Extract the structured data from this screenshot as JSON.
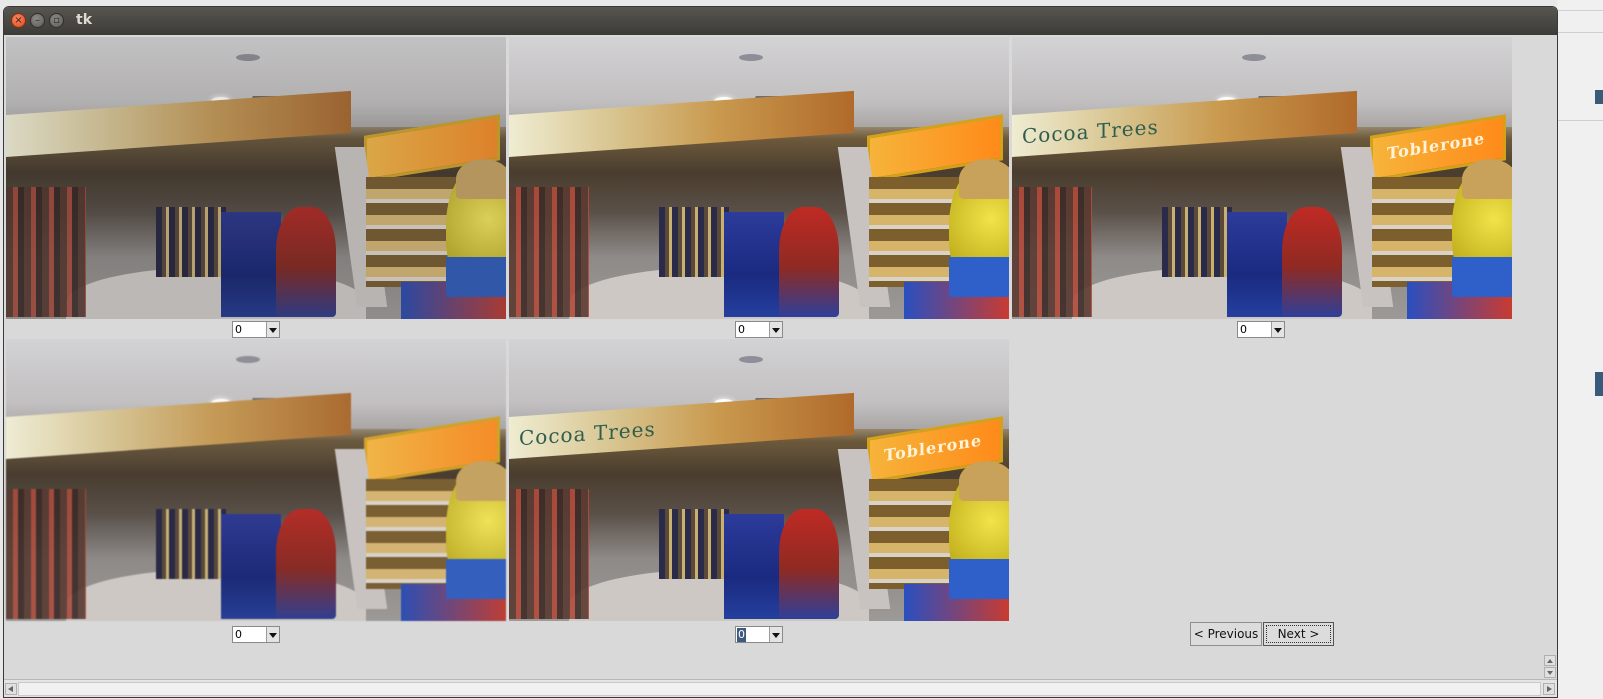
{
  "window": {
    "title": "tk"
  },
  "titlebar_buttons": {
    "close": "×",
    "minimize": "–",
    "maximize": "▫"
  },
  "images": [
    {
      "banner_text": "",
      "sign_text": ""
    },
    {
      "banner_text": "",
      "sign_text": ""
    },
    {
      "banner_text": "Cocoa Trees",
      "sign_text": "Toblerone"
    },
    {
      "banner_text": "",
      "sign_text": ""
    },
    {
      "banner_text": "Cocoa Trees",
      "sign_text": "Toblerone"
    }
  ],
  "selectors": [
    {
      "value": "0"
    },
    {
      "value": "0"
    },
    {
      "value": "0"
    },
    {
      "value": "0"
    },
    {
      "value": "0",
      "selected": true
    }
  ],
  "nav": {
    "previous_label": "< Previous",
    "next_label": "Next >"
  }
}
